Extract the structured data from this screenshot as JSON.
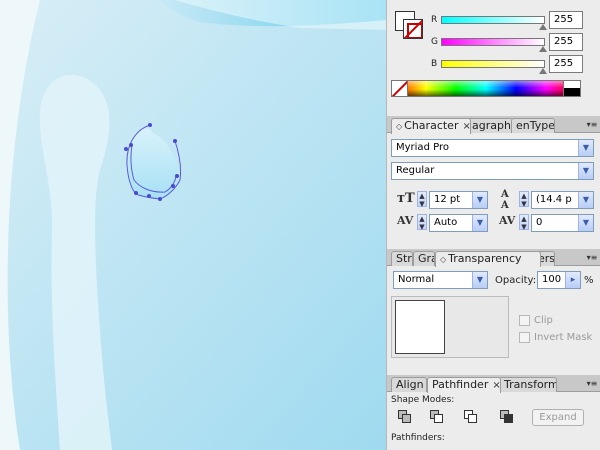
{
  "color_panel": {
    "channels": [
      {
        "label": "R",
        "value": "255",
        "level": 1.0,
        "color": "#00e5ff"
      },
      {
        "label": "G",
        "value": "255",
        "level": 1.0,
        "color": "#ff00ff"
      },
      {
        "label": "B",
        "value": "255",
        "level": 1.0,
        "color": "#ffff00"
      }
    ],
    "fill_color": "#ffffff"
  },
  "character_panel": {
    "tabs": [
      {
        "label": "Character",
        "active": true
      },
      {
        "label": "agraph",
        "active": false
      },
      {
        "label": "enType",
        "active": false
      }
    ],
    "font_family": "Myriad Pro",
    "font_style": "Regular",
    "font_size": "12 pt",
    "leading": "(14.4 p",
    "kerning": "Auto",
    "tracking": "0"
  },
  "transparency_panel": {
    "tabs": [
      {
        "label": "Stro",
        "active": false
      },
      {
        "label": "Gra",
        "active": false
      },
      {
        "label": "Transparency",
        "active": true
      },
      {
        "label": "ers",
        "active": false
      }
    ],
    "blend_mode": "Normal",
    "opacity_label": "Opacity:",
    "opacity_value": "100",
    "opacity_unit": "%",
    "clip_label": "Clip",
    "invert_mask_label": "Invert Mask"
  },
  "pathfinder_panel": {
    "tabs": [
      {
        "label": "Align",
        "active": false
      },
      {
        "label": "Pathfinder",
        "active": true
      },
      {
        "label": "Transform",
        "active": false
      }
    ],
    "shape_modes_label": "Shape Modes:",
    "expand_label": "Expand",
    "pathfinders_label": "Pathfinders:"
  },
  "icons": {
    "close": "×",
    "dropdown": "▼",
    "panel_menu": "▾≡",
    "collapse": "▲▲",
    "tab_arrow": "◇"
  }
}
